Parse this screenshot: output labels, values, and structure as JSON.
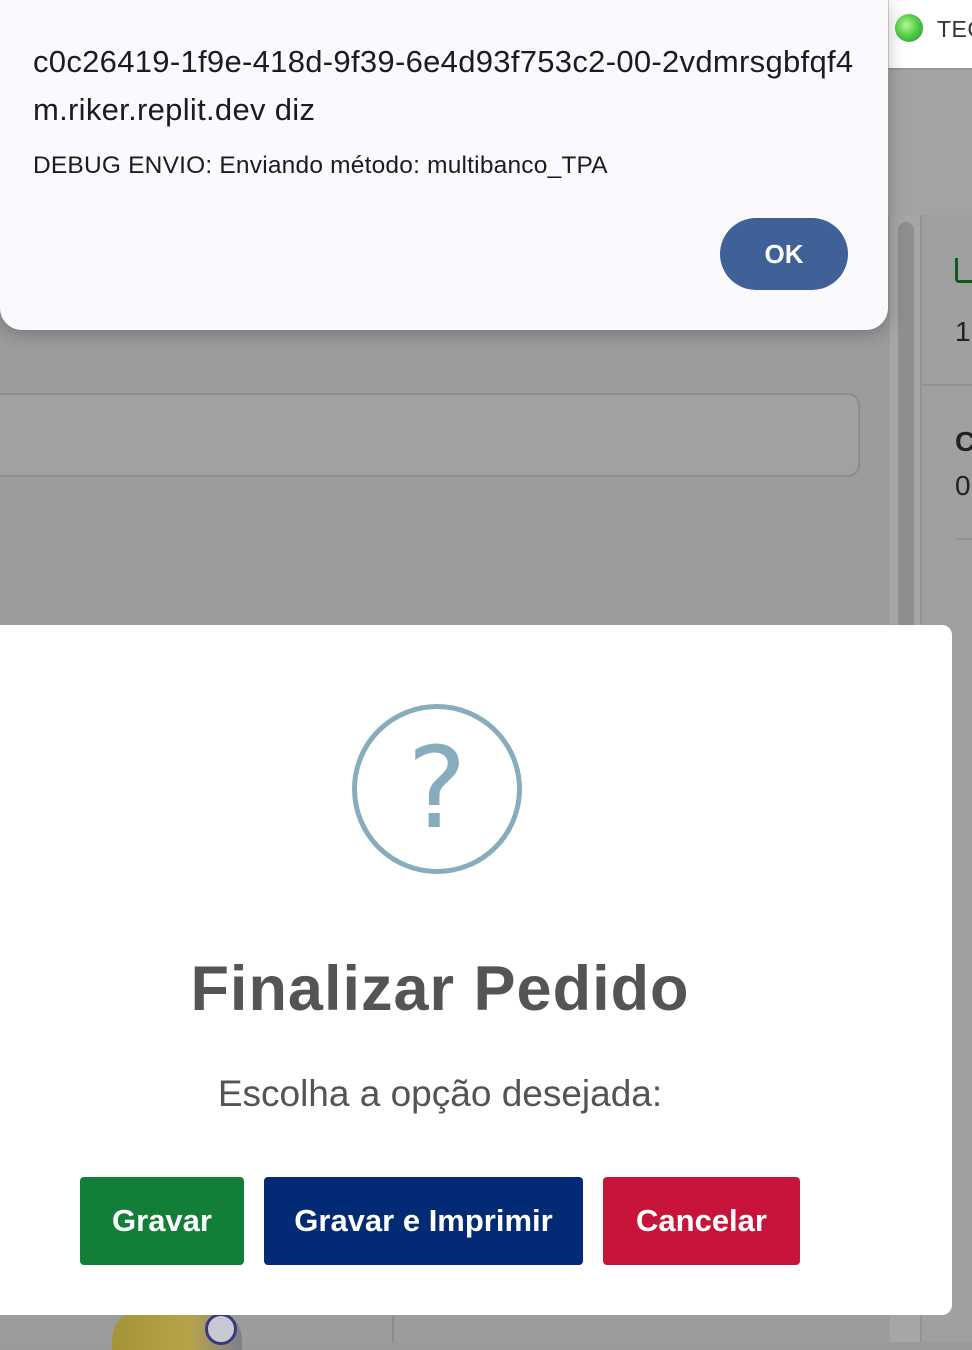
{
  "browser_tab": {
    "label": "TEC",
    "icon": "app-favicon-icon"
  },
  "background": {
    "right_panel": {
      "line1": "1",
      "line2": "C",
      "line3": "0,"
    },
    "cart_icon": "cart-icon"
  },
  "alert": {
    "title": "c0c26419-1f9e-418d-9f39-6e4d93f753c2-00-2vdmrsgbfqf4m.riker.replit.dev diz",
    "message": "DEBUG ENVIO: Enviando método: multibanco_TPA",
    "ok_label": "OK",
    "ok_color": "#3f6198"
  },
  "modal": {
    "icon": "question-icon",
    "icon_glyph": "?",
    "title": "Finalizar Pedido",
    "text": "Escolha a opção desejada:",
    "buttons": {
      "save": {
        "label": "Gravar",
        "color": "#137e37"
      },
      "save_print": {
        "label": "Gravar e Imprimir",
        "color": "#032a75"
      },
      "cancel": {
        "label": "Cancelar",
        "color": "#c8133a"
      }
    }
  }
}
